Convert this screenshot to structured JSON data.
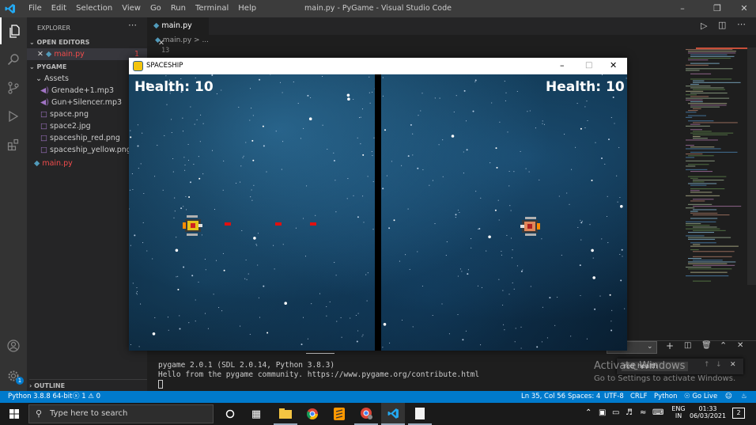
{
  "vscode": {
    "window_title": "main.py - PyGame - Visual Studio Code",
    "menu": [
      "File",
      "Edit",
      "Selection",
      "View",
      "Go",
      "Run",
      "Terminal",
      "Help"
    ],
    "explorer_title": "EXPLORER",
    "open_editors_label": "OPEN EDITORS",
    "open_editor_file": "main.py",
    "open_editor_badge": "1",
    "project_label": "PYGAME",
    "folder_assets": "Assets",
    "files": [
      "Grenade+1.mp3",
      "Gun+Silencer.mp3",
      "space.png",
      "space2.jpg",
      "spaceship_red.png",
      "spaceship_yellow.png"
    ],
    "root_file": "main.py",
    "outline_label": "OUTLINE",
    "tab_label": "main.py",
    "breadcrumb": "main.py > ...",
    "line_number": "13",
    "terminal_lines": [
      "pygame 2.0.1 (SDL 2.0.14, Python 3.8.3)",
      "Hello from the pygame community. https://www.pygame.org/contribute.html"
    ],
    "find_widget_text": "red_health",
    "activate_title": "Activate Windows",
    "activate_sub": "Go to Settings to activate Windows."
  },
  "status": {
    "python": "Python 3.8.8 64-bit",
    "problems": "ⓧ 1 ⚠ 0",
    "position": "Ln 35, Col 56",
    "spaces": "Spaces: 4",
    "encoding": "UTF-8",
    "eol": "CRLF",
    "language": "Python",
    "golive": "Go Live"
  },
  "pygame": {
    "window_title": "SPACESHIP",
    "left_health": "Health: 10",
    "right_health": "Health: 10"
  },
  "taskbar": {
    "search_placeholder": "Type here to search",
    "lang": "ENG",
    "region": "IN",
    "time": "01:33",
    "date": "06/03/2021",
    "notif_count": "2"
  },
  "colors": {
    "accent": "#007acc",
    "bullet": "#e01010",
    "error_red": "#f14c4c"
  }
}
